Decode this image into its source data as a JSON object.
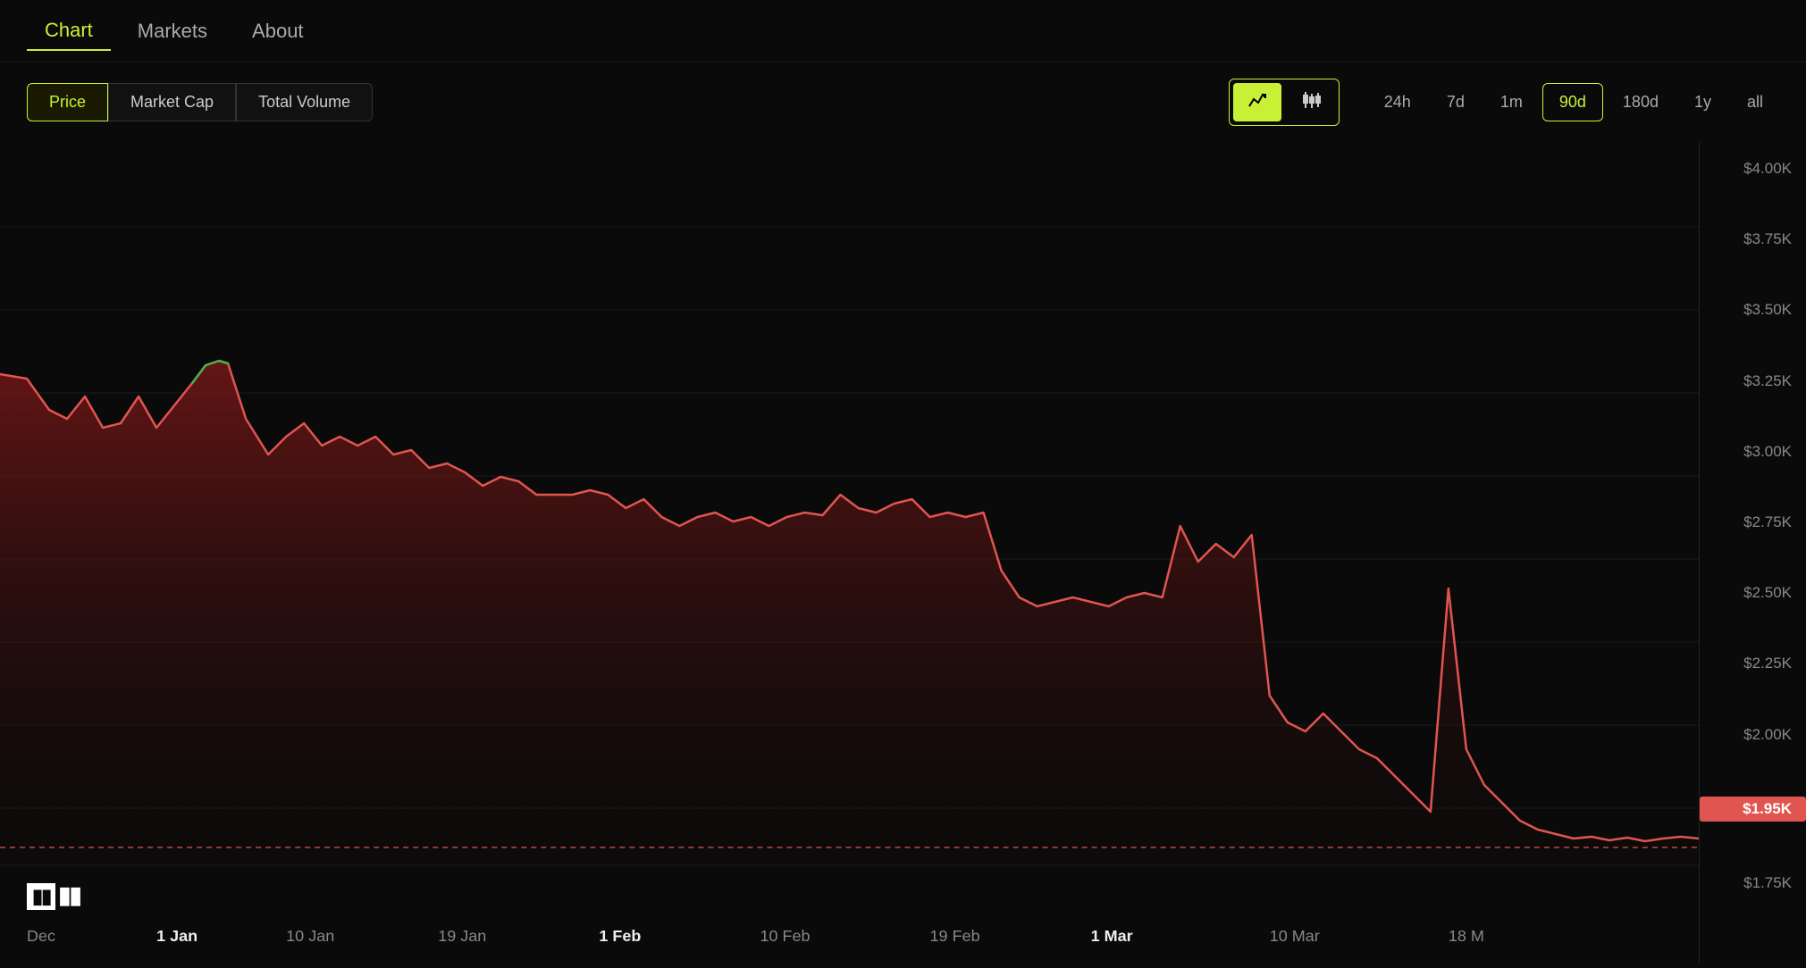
{
  "nav": {
    "items": [
      {
        "label": "Chart",
        "active": true
      },
      {
        "label": "Markets",
        "active": false
      },
      {
        "label": "About",
        "active": false
      }
    ]
  },
  "toolbar": {
    "metric_tabs": [
      {
        "label": "Price",
        "active": true
      },
      {
        "label": "Market Cap",
        "active": false
      },
      {
        "label": "Total Volume",
        "active": false
      }
    ],
    "chart_types": [
      {
        "label": "📈",
        "icon": "line-chart-icon",
        "active": true
      },
      {
        "label": "⊞",
        "icon": "candlestick-icon",
        "active": false
      }
    ],
    "time_ranges": [
      {
        "label": "24h",
        "active": false
      },
      {
        "label": "7d",
        "active": false
      },
      {
        "label": "1m",
        "active": false
      },
      {
        "label": "90d",
        "active": true
      },
      {
        "label": "180d",
        "active": false
      },
      {
        "label": "1y",
        "active": false
      },
      {
        "label": "all",
        "active": false
      }
    ]
  },
  "chart": {
    "current_price": "$1.95K",
    "y_labels": [
      "$4.00K",
      "$3.75K",
      "$3.50K",
      "$3.25K",
      "$3.00K",
      "$2.75K",
      "$2.50K",
      "$2.25K",
      "$2.00K",
      "$1.75K"
    ],
    "x_labels": [
      {
        "label": "Dec",
        "pct": 2
      },
      {
        "label": "1 Jan",
        "pct": 10,
        "bold": true
      },
      {
        "label": "10 Jan",
        "pct": 18
      },
      {
        "label": "19 Jan",
        "pct": 27
      },
      {
        "label": "1 Feb",
        "pct": 37,
        "bold": true
      },
      {
        "label": "10 Feb",
        "pct": 46
      },
      {
        "label": "19 Feb",
        "pct": 55
      },
      {
        "label": "1 Mar",
        "pct": 64,
        "bold": true
      },
      {
        "label": "10 Mar",
        "pct": 73
      },
      {
        "label": "18 M",
        "pct": 82
      }
    ],
    "price_range": {
      "min": 1750,
      "max": 4000
    }
  },
  "logo": {
    "text": "TV",
    "brand": "TradingView"
  }
}
